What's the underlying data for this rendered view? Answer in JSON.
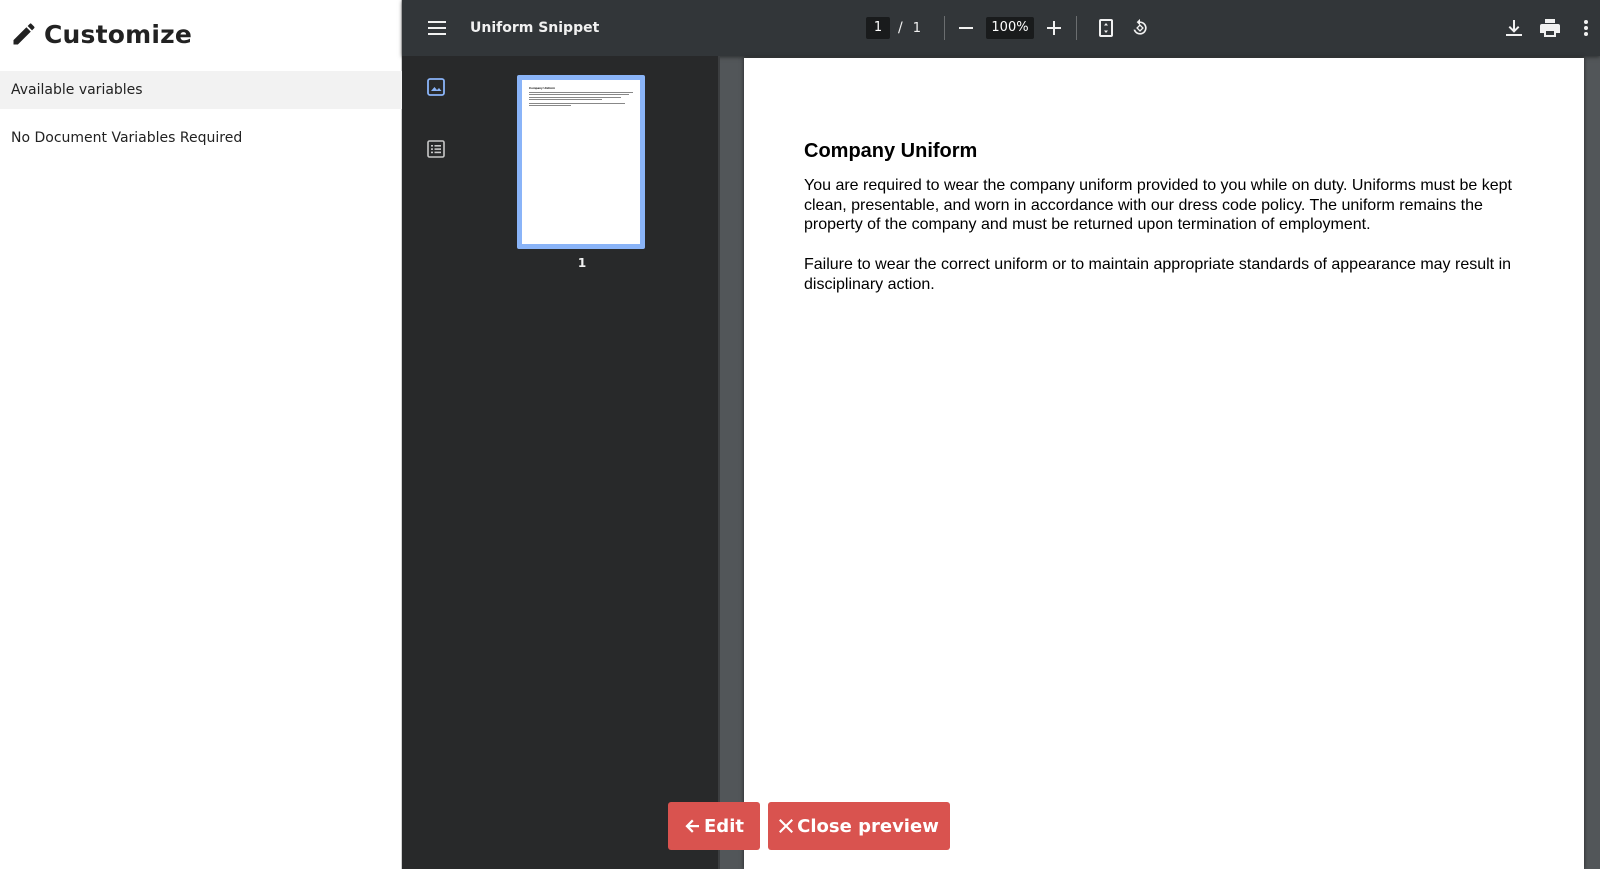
{
  "left_panel": {
    "title": "Customize",
    "title_icon": "pencil-icon",
    "section_header": "Available variables",
    "empty_message": "No Document Variables Required"
  },
  "viewer": {
    "toolbar": {
      "menu_icon": "hamburger-menu-icon",
      "title": "Uniform Snippet",
      "page_current": "1",
      "page_separator": "/",
      "page_total": "1",
      "zoom": "100%",
      "icons": [
        "zoom-out-icon",
        "zoom-in-icon",
        "fit-page-icon",
        "rotate-icon",
        "download-icon",
        "print-icon",
        "more-vert-icon"
      ]
    },
    "sidebar": {
      "icons": [
        "thumbnails-icon",
        "outline-icon"
      ],
      "thumbnail_label": "1"
    },
    "document": {
      "heading": "Company Uniform",
      "paragraphs": [
        "You are required to wear the company uniform provided to you while on duty. Uniforms must be kept clean, presentable, and worn in accordance with our dress code policy. The uniform remains the property of the company and must be returned upon termination of employment.",
        "Failure to wear the correct uniform or to maintain appropriate standards of appearance may result in disciplinary action."
      ]
    }
  },
  "actions": {
    "edit_label": "Edit",
    "close_label": "Close preview"
  },
  "colors": {
    "button_red": "#d9534f",
    "toolbar": "#323639",
    "sidebar": "#28292a",
    "thumb_highlight": "#8ab4f8"
  }
}
